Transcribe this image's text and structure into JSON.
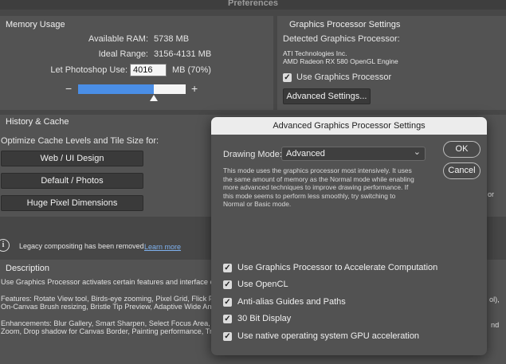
{
  "window": {
    "title": "Preferences"
  },
  "memory": {
    "title": "Memory Usage",
    "available_label": "Available RAM:",
    "available_value": "5738 MB",
    "ideal_label": "Ideal Range:",
    "ideal_value": "3156-4131 MB",
    "use_label": "Let Photoshop Use:",
    "use_value": "4016",
    "use_unit": "MB (70%)",
    "minus": "−",
    "plus": "+",
    "slider_fraction": 0.7
  },
  "gpu": {
    "title": "Graphics Processor Settings",
    "detected_label": "Detected Graphics Processor:",
    "vendor": "ATI Technologies Inc.",
    "model": "AMD Radeon RX 580 OpenGL Engine",
    "use_gpu_label": "Use Graphics Processor",
    "use_gpu_checked": true,
    "advanced_button": "Advanced Settings..."
  },
  "history": {
    "title": "History & Cache",
    "optimize_label": "Optimize Cache Levels and Tile Size for:",
    "buttons": [
      "Web / UI Design",
      "Default / Photos",
      "Huge Pixel Dimensions"
    ]
  },
  "legacy": {
    "icon": "info-icon",
    "text": "Legacy compositing has been removed",
    "link": "Learn more"
  },
  "description": {
    "title": "Description",
    "line1": "Use Graphics Processor activates certain features and interface enha",
    "features_a": "Features: Rotate View tool, Birds-eye zooming, Pixel Grid, Flick Pann",
    "features_b": "On-Canvas Brush resizing, Bristle Tip Preview, Adaptive Wide Angle,",
    "features_right": "ol),",
    "enh_a": "Enhancements: Blur Gallery, Smart Sharpen, Select Focus Area, and",
    "enh_b": "Zoom, Drop shadow for Canvas Border, Painting performance, Transf",
    "enh_right": "nd"
  },
  "right_edge_text": "or",
  "modal": {
    "title": "Advanced Graphics Processor Settings",
    "mode_label": "Drawing Mode:",
    "mode_value": "Advanced",
    "ok": "OK",
    "cancel": "Cancel",
    "desc_lines": [
      "This mode uses the graphics processor most intensively.  It uses",
      "the same amount of memory as the Normal mode while enabling",
      "more advanced techniques to improve drawing performance.  If",
      "this mode seems to perform less smoothly, try switching to",
      "Normal or Basic mode."
    ],
    "options": [
      {
        "label": "Use Graphics Processor to Accelerate Computation",
        "checked": true
      },
      {
        "label": "Use OpenCL",
        "checked": true
      },
      {
        "label": "Anti-alias Guides and Paths",
        "checked": true
      },
      {
        "label": "30 Bit Display",
        "checked": true
      },
      {
        "label": "Use native operating system GPU acceleration",
        "checked": true
      }
    ]
  },
  "colors": {
    "slider_fill": "#4a8ee6",
    "link": "#7fb2f0"
  }
}
